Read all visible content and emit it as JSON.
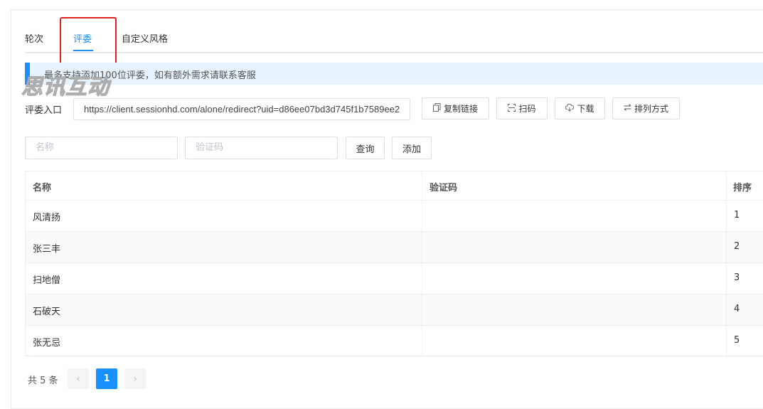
{
  "tabs": [
    {
      "label": "轮次"
    },
    {
      "label": "评委"
    },
    {
      "label": "自定义风格"
    }
  ],
  "active_tab": "评委",
  "notice": {
    "text": "最多支持添加100位评委，如有额外需求请联系客服"
  },
  "watermark": {
    "text": "思讯互动"
  },
  "entry": {
    "label": "评委入口",
    "url": "https://client.sessionhd.com/alone/redirect?uid=d86ee07bd3d745f1b7589ee2",
    "buttons": {
      "copy": "复制链接",
      "scan": "扫码",
      "download": "下载",
      "sort": "排列方式"
    },
    "icons": {
      "copy": "copy-icon",
      "scan": "scan-icon",
      "download": "download-icon",
      "sort": "swap-icon"
    }
  },
  "search": {
    "name_placeholder": "名称",
    "code_placeholder": "验证码",
    "query_label": "查询",
    "add_label": "添加"
  },
  "table": {
    "columns": [
      "名称",
      "验证码",
      "排序"
    ],
    "rows": [
      {
        "name": "风清扬",
        "code": "",
        "order": "1"
      },
      {
        "name": "张三丰",
        "code": "",
        "order": "2"
      },
      {
        "name": "扫地僧",
        "code": "",
        "order": "3"
      },
      {
        "name": "石破天",
        "code": "",
        "order": "4"
      },
      {
        "name": "张无忌",
        "code": "",
        "order": "5"
      }
    ]
  },
  "pagination": {
    "total_text": "共 5 条",
    "current_page": "1",
    "prev": "‹",
    "next": "›"
  },
  "colors": {
    "accent": "#1890ff",
    "highlight": "#e02020",
    "notice_bg": "#e6f2fc"
  }
}
